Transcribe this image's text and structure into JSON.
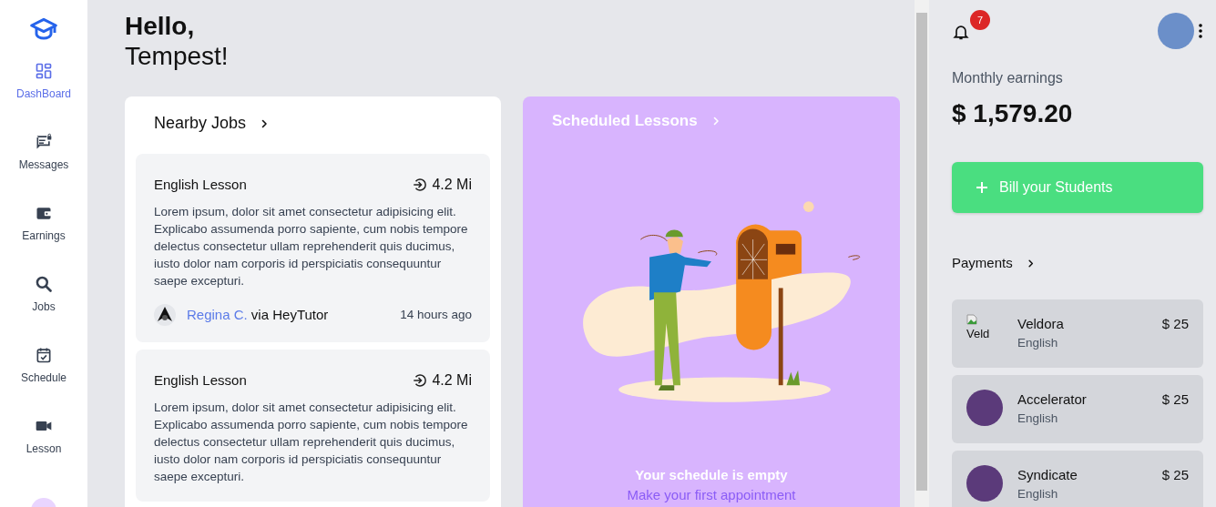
{
  "sidebar": {
    "items": [
      {
        "label": "DashBoard",
        "selected": true
      },
      {
        "label": "Messages",
        "selected": false
      },
      {
        "label": "Earnings",
        "selected": false
      },
      {
        "label": "Jobs",
        "selected": false
      },
      {
        "label": "Schedule",
        "selected": false
      },
      {
        "label": "Lesson",
        "selected": false
      }
    ]
  },
  "greeting": {
    "line_1": "Hello,",
    "line_2": "Tempest!"
  },
  "nearby_jobs": {
    "title": "Nearby Jobs",
    "jobs": [
      {
        "title": "English Lesson",
        "distance": "4.2 Mi",
        "description": "Lorem ipsum, dolor sit amet consectetur adipisicing elit. Explicabo assumenda porro sapiente, cum nobis tempore delectus consectetur ullam reprehenderit quis ducimus, iusto dolor nam corporis id perspiciatis consequuntur saepe excepturi.",
        "tutor": "Regina C.",
        "via": "via HeyTutor",
        "time": "14 hours ago"
      },
      {
        "title": "English Lesson",
        "distance": "4.2 Mi",
        "description": "Lorem ipsum, dolor sit amet consectetur adipisicing elit. Explicabo assumenda porro sapiente, cum nobis tempore delectus consectetur ullam reprehenderit quis ducimus, iusto dolor nam corporis id perspiciatis consequuntur saepe excepturi."
      }
    ]
  },
  "scheduled_lessons": {
    "title": "Scheduled Lessons",
    "empty_title": "Your schedule is empty",
    "empty_link": "Make your first appointment"
  },
  "notifications": {
    "count": "7"
  },
  "earnings": {
    "label": "Monthly earnings",
    "amount": "$ 1,579.20"
  },
  "bill_button": {
    "label": "Bill your Students"
  },
  "payments": {
    "title": "Payments",
    "items": [
      {
        "name": "Veldora",
        "subject": "English",
        "amount": "$ 25",
        "kind": "broken",
        "alt": "Veld"
      },
      {
        "name": "Accelerator",
        "subject": "English",
        "amount": "$ 25",
        "kind": "image"
      },
      {
        "name": "Syndicate",
        "subject": "English",
        "amount": "$ 25",
        "kind": "image"
      }
    ]
  }
}
